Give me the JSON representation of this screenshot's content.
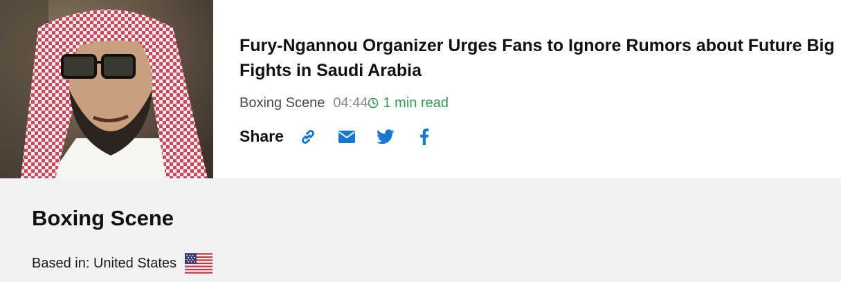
{
  "article": {
    "title": "Fury-Ngannou Organizer Urges Fans to Ignore Rumors about Future Big Fights in Saudi Arabia",
    "source": "Boxing Scene",
    "time": "04:44",
    "read_time": "1 min read",
    "share_label": "Share",
    "share_buttons": [
      {
        "icon": "link-icon"
      },
      {
        "icon": "mail-icon"
      },
      {
        "icon": "twitter-icon"
      },
      {
        "icon": "facebook-icon"
      }
    ]
  },
  "publisher": {
    "name": "Boxing Scene",
    "based_in": "Based in: United States",
    "flag": "us-flag-icon"
  },
  "colors": {
    "accent_blue": "#1877d2",
    "read_time_green": "#2e9a4e",
    "panel_bg": "#f2f1f4"
  }
}
